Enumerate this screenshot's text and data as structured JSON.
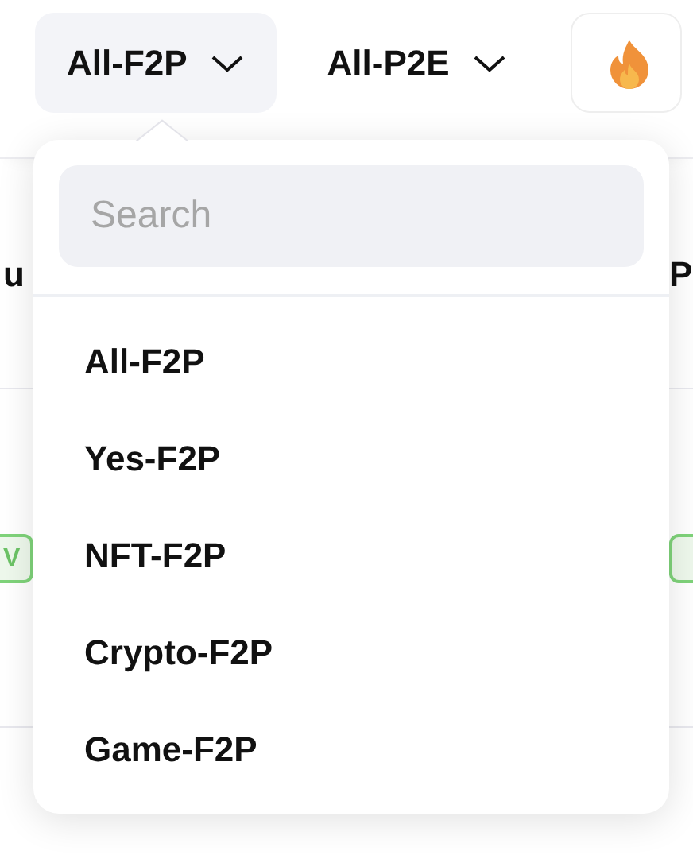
{
  "filters": [
    {
      "label": "All-F2P",
      "kind": "select",
      "selected": true
    },
    {
      "label": "All-P2E",
      "kind": "select",
      "selected": false
    },
    {
      "kind": "hot"
    }
  ],
  "table": {
    "columns": [
      "u",
      "P"
    ],
    "badges": [
      "V"
    ]
  },
  "dropdown": {
    "search": {
      "placeholder": "Search"
    },
    "options": [
      "All-F2P",
      "Yes-F2P",
      "NFT-F2P",
      "Crypto-F2P",
      "Game-F2P"
    ]
  }
}
